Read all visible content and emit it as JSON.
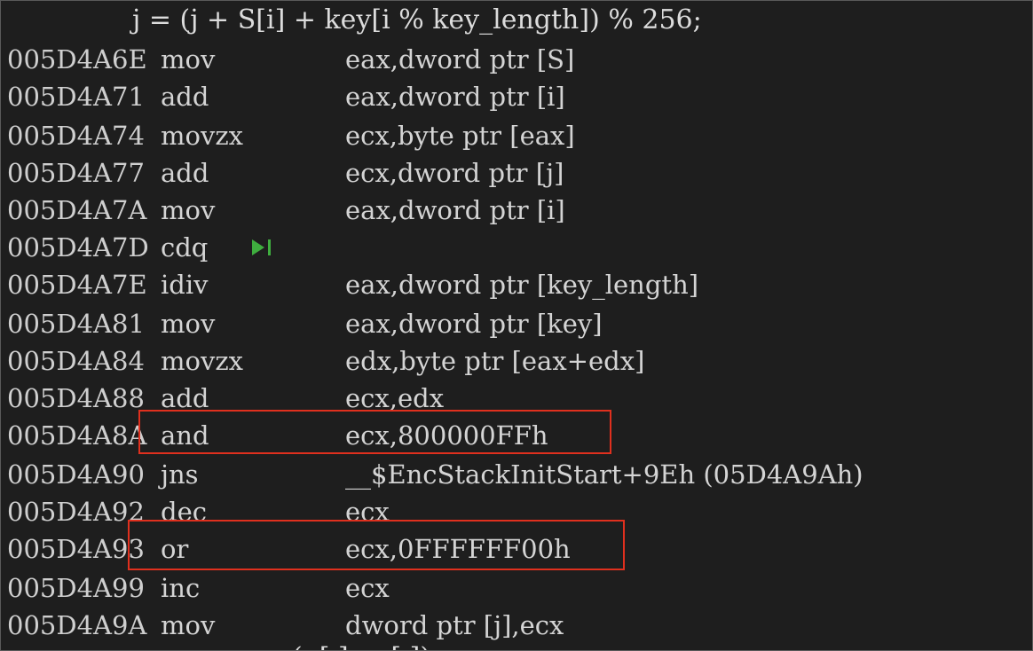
{
  "source_line": "j = (j + S[i] + key[i % key_length]) % 256;",
  "instructions": [
    {
      "address": "005D4A6E",
      "mnemonic": "mov",
      "operands": "eax,dword ptr [S]"
    },
    {
      "address": "005D4A71",
      "mnemonic": "add",
      "operands": "eax,dword ptr [i]"
    },
    {
      "address": "005D4A74",
      "mnemonic": "movzx",
      "operands": "ecx,byte ptr [eax]"
    },
    {
      "address": "005D4A77",
      "mnemonic": "add",
      "operands": "ecx,dword ptr [j]"
    },
    {
      "address": "005D4A7A",
      "mnemonic": "mov",
      "operands": "eax,dword ptr [i]"
    },
    {
      "address": "005D4A7D",
      "mnemonic": "cdq",
      "operands": ""
    },
    {
      "address": "005D4A7E",
      "mnemonic": "idiv",
      "operands": "eax,dword ptr [key_length]"
    },
    {
      "address": "005D4A81",
      "mnemonic": "mov",
      "operands": "eax,dword ptr [key]"
    },
    {
      "address": "005D4A84",
      "mnemonic": "movzx",
      "operands": "edx,byte ptr [eax+edx]"
    },
    {
      "address": "005D4A88",
      "mnemonic": "add",
      "operands": "ecx,edx"
    },
    {
      "address": "005D4A8A",
      "mnemonic": "and",
      "operands": "ecx,800000FFh"
    },
    {
      "address": "005D4A90",
      "mnemonic": "jns",
      "operands": "__$EncStackInitStart+9Eh (05D4A9Ah)"
    },
    {
      "address": "005D4A92",
      "mnemonic": "dec",
      "operands": "ecx"
    },
    {
      "address": "005D4A93",
      "mnemonic": "or",
      "operands": "ecx,0FFFFFF00h"
    },
    {
      "address": "005D4A99",
      "mnemonic": "inc",
      "operands": "ecx"
    },
    {
      "address": "005D4A9A",
      "mnemonic": "mov",
      "operands": "dword ptr [j],ecx"
    }
  ],
  "next_source_partial": "(  [ ]     [ ])",
  "colors": {
    "background": "#1e1e1e",
    "text": "#dcdcdc",
    "highlight_border": "#e0301e",
    "run_to_cursor_icon": "#3fae3f"
  },
  "icons": {
    "run_to_cursor": "run-to-cursor-icon"
  }
}
